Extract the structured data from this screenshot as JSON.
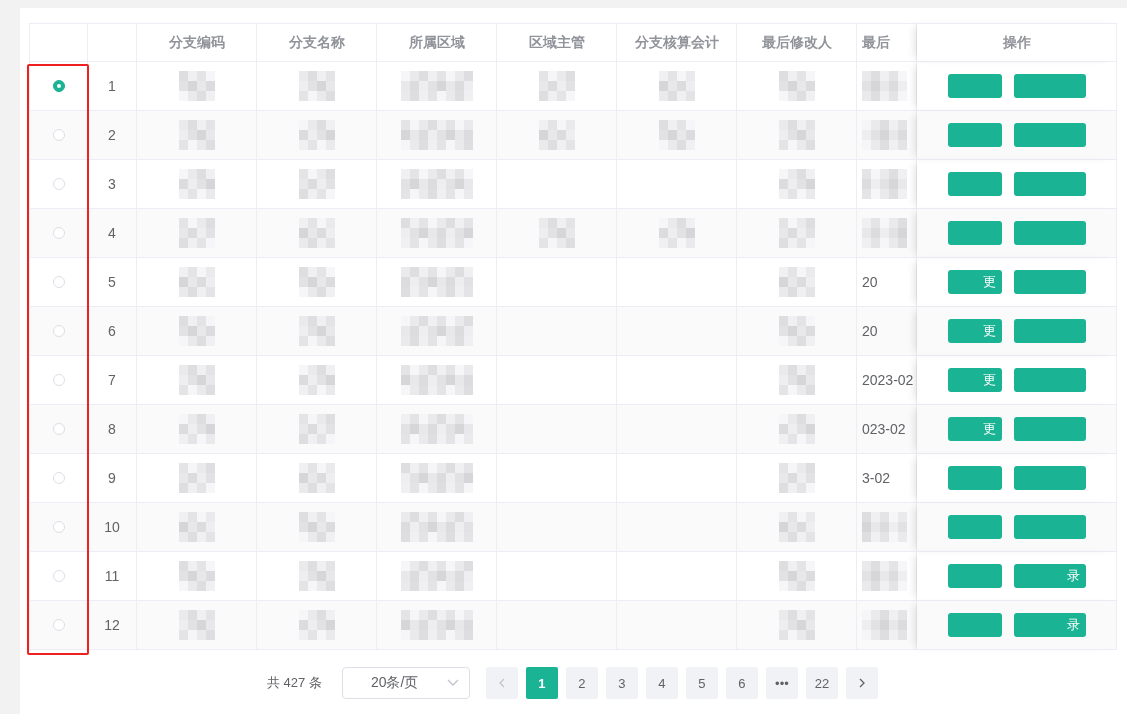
{
  "table": {
    "columns": [
      "分支编码",
      "分支名称",
      "所属区域",
      "区域主管",
      "分支核算会计",
      "最后修改人",
      "最后"
    ],
    "action_column": "操作",
    "rows": [
      {
        "index": "1",
        "selected": true,
        "redacted": [
          true,
          true,
          true,
          true,
          true,
          true,
          true
        ]
      },
      {
        "index": "2",
        "selected": false,
        "redacted": [
          true,
          true,
          true,
          true,
          true,
          true,
          true
        ]
      },
      {
        "index": "3",
        "selected": false,
        "redacted": [
          true,
          true,
          true,
          false,
          false,
          true,
          true
        ]
      },
      {
        "index": "4",
        "selected": false,
        "redacted": [
          true,
          true,
          true,
          true,
          true,
          true,
          true
        ]
      },
      {
        "index": "5",
        "selected": false,
        "redacted": [
          true,
          true,
          true,
          false,
          false,
          true,
          false
        ],
        "date_fragment": "20",
        "edit_fragment": "更"
      },
      {
        "index": "6",
        "selected": false,
        "redacted": [
          true,
          true,
          true,
          false,
          false,
          true,
          false
        ],
        "date_fragment": "20",
        "edit_fragment": "更"
      },
      {
        "index": "7",
        "selected": false,
        "redacted": [
          true,
          true,
          true,
          false,
          false,
          true,
          false
        ],
        "date_fragment": "2023-02",
        "edit_fragment": "更"
      },
      {
        "index": "8",
        "selected": false,
        "redacted": [
          true,
          true,
          true,
          false,
          false,
          true,
          false
        ],
        "date_fragment": "023-02",
        "edit_fragment": "更"
      },
      {
        "index": "9",
        "selected": false,
        "redacted": [
          true,
          true,
          true,
          false,
          false,
          true,
          false
        ],
        "date_fragment": "3-02"
      },
      {
        "index": "10",
        "selected": false,
        "redacted": [
          true,
          true,
          true,
          false,
          false,
          true,
          true
        ]
      },
      {
        "index": "11",
        "selected": false,
        "redacted": [
          true,
          true,
          true,
          false,
          false,
          true,
          true
        ],
        "log_fragment": "录"
      },
      {
        "index": "12",
        "selected": false,
        "redacted": [
          true,
          true,
          true,
          false,
          false,
          true,
          true
        ],
        "log_fragment": "录"
      }
    ]
  },
  "pagination": {
    "total": "共 427 条",
    "page_size": "20条/页",
    "pages": [
      {
        "label": "1",
        "selected": true
      },
      {
        "label": "2",
        "selected": false
      },
      {
        "label": "3",
        "selected": false
      },
      {
        "label": "4",
        "selected": false
      },
      {
        "label": "5",
        "selected": false
      },
      {
        "label": "6",
        "selected": false
      },
      {
        "label": "•••",
        "selected": false
      },
      {
        "label": "22",
        "selected": false
      }
    ]
  }
}
